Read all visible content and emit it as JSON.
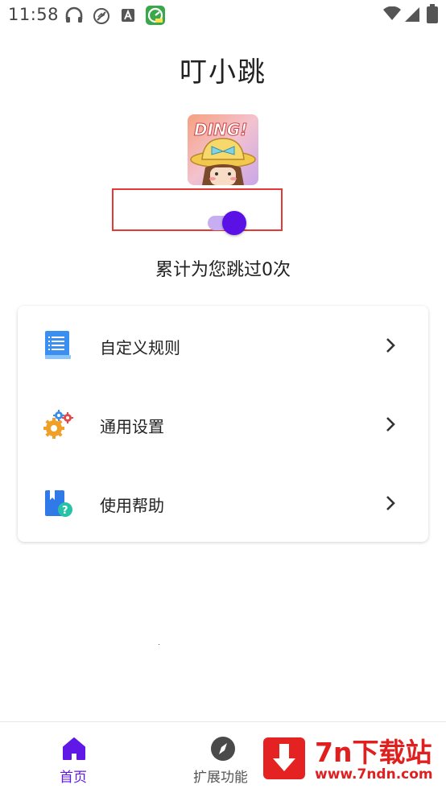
{
  "status_bar": {
    "time": "11:58",
    "left_icons": [
      "headset-icon",
      "no-sync-icon",
      "keyboard-a-icon",
      "speed-app-icon"
    ],
    "right_icons": [
      "wifi-icon",
      "signal-icon",
      "battery-icon"
    ]
  },
  "header": {
    "app_name": "叮小跳"
  },
  "logo": {
    "text": "DING!"
  },
  "service_toggle": {
    "on": true
  },
  "stats": {
    "skip_text": "累计为您跳过0次"
  },
  "menu": {
    "items": [
      {
        "label": "自定义规则",
        "icon": "document-icon"
      },
      {
        "label": "通用设置",
        "icon": "gears-icon"
      },
      {
        "label": "使用帮助",
        "icon": "help-book-icon"
      }
    ]
  },
  "bottom_nav": {
    "items": [
      {
        "label": "首页",
        "icon": "home-icon",
        "active": true
      },
      {
        "label": "扩展功能",
        "icon": "compass-icon",
        "active": false
      }
    ]
  },
  "watermark": {
    "title": "7n下载站",
    "url": "www.7ndn.com"
  },
  "colors": {
    "accent": "#5b10e6",
    "track": "#c7aef3",
    "highlight": "#e53935",
    "watermark": "#e01f1f"
  }
}
